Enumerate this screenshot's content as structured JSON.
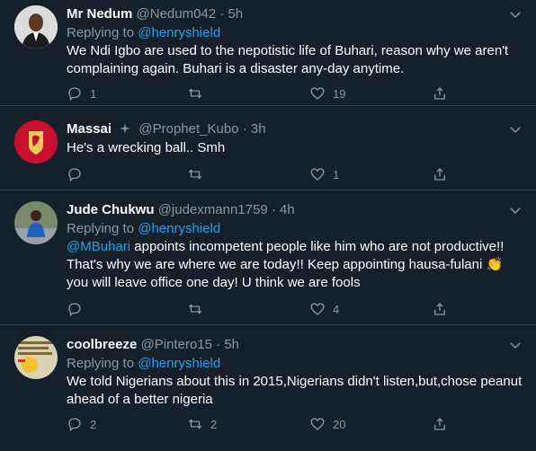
{
  "tweets": [
    {
      "name": "Mr Nedum",
      "handle": "@Nedum042",
      "time": "5h",
      "replying_prefix": "Replying to ",
      "replying_to": "@henryshield",
      "text": "We Ndi Igbo are used to the nepotistic life of Buhari, reason why we aren't complaining again. Buhari is a disaster any-day anytime.",
      "replies": "1",
      "retweets": "",
      "likes": "19"
    },
    {
      "name": "Massai",
      "handle": "@Prophet_Kubo",
      "time": "3h",
      "text": "He's a wrecking ball.. Smh",
      "replies": "",
      "retweets": "",
      "likes": "1"
    },
    {
      "name": "Jude Chukwu",
      "handle": "@judexmann1759",
      "time": "4h",
      "replying_prefix": "Replying to ",
      "replying_to": "@henryshield",
      "mention": "@MBuhari",
      "text": " appoints incompetent people like him who are not productive!! That's why we are where we are today!! Keep appointing hausa-fulani 👏 you will leave office one day! U think we are fools",
      "replies": "",
      "retweets": "",
      "likes": "4"
    },
    {
      "name": "coolbreeze",
      "handle": "@Pintero15",
      "time": "5h",
      "replying_prefix": "Replying to ",
      "replying_to": "@henryshield",
      "text": "We told Nigerians about this in 2015,Nigerians didn't listen,but,chose peanut ahead of a better nigeria",
      "replies": "2",
      "retweets": "2",
      "likes": "20"
    }
  ],
  "separator": " · ",
  "colors": {
    "background": "#15202b",
    "muted": "#8899a6",
    "link": "#1da1f2",
    "divider": "#38444d"
  }
}
